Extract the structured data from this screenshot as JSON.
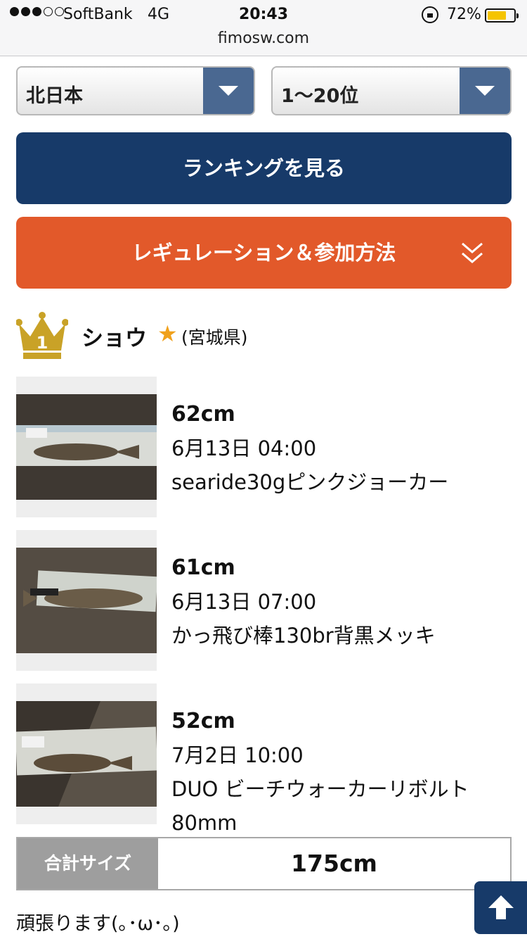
{
  "status_bar": {
    "carrier": "SoftBank",
    "network": "4G",
    "time": "20:43",
    "battery_pct": "72%",
    "battery_level": 0.72
  },
  "url_bar": {
    "domain": "fimosw.com"
  },
  "filters": {
    "region": "北日本",
    "rank_range": "1〜20位"
  },
  "buttons": {
    "view_ranking": "ランキングを見る",
    "regulation": "レギュレーション＆参加方法"
  },
  "rank_entry": {
    "rank": "1",
    "name": "ショウ",
    "star": "★",
    "prefecture": "(宮城県)",
    "catches": [
      {
        "size": "62cm",
        "datetime": "6月13日 04:00",
        "lure": "searide30gピンクジョーカー"
      },
      {
        "size": "61cm",
        "datetime": "6月13日 07:00",
        "lure": "かっ飛び棒130br背黒メッキ"
      },
      {
        "size": "52cm",
        "datetime": "7月2日 10:00",
        "lure": "DUO ビーチウォーカーリボルト 80mm"
      }
    ],
    "total_label": "合計サイズ",
    "total_value": "175cm",
    "comment": "頑張ります(｡･ω･｡)"
  },
  "icons": {
    "crown": "crown-icon",
    "dropdown": "chevron-down-icon",
    "expand": "double-chevron-down-icon",
    "back_to_top": "arrow-up-icon"
  },
  "colors": {
    "navy": "#173a69",
    "orange": "#e2592a",
    "gold": "#c9a227",
    "dropdown_arrow_bg": "#4a6891",
    "total_label_bg": "#9e9e9e"
  }
}
